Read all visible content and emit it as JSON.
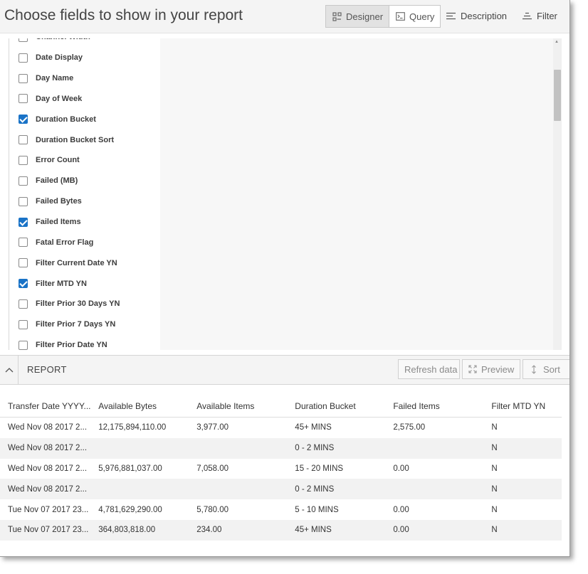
{
  "header": {
    "title": "Choose fields to show in your report",
    "designer_label": "Designer",
    "query_label": "Query",
    "description_label": "Description",
    "filter_label": "Filter"
  },
  "fields": [
    {
      "label": "Channel Width",
      "checked": false
    },
    {
      "label": "Date Display",
      "checked": false
    },
    {
      "label": "Day Name",
      "checked": false
    },
    {
      "label": "Day of Week",
      "checked": false
    },
    {
      "label": "Duration Bucket",
      "checked": true
    },
    {
      "label": "Duration Bucket Sort",
      "checked": false
    },
    {
      "label": "Error Count",
      "checked": false
    },
    {
      "label": "Failed (MB)",
      "checked": false
    },
    {
      "label": "Failed Bytes",
      "checked": false
    },
    {
      "label": "Failed Items",
      "checked": true
    },
    {
      "label": "Fatal Error Flag",
      "checked": false
    },
    {
      "label": "Filter Current Date YN",
      "checked": false
    },
    {
      "label": "Filter MTD YN",
      "checked": true
    },
    {
      "label": "Filter Prior 30 Days YN",
      "checked": false
    },
    {
      "label": "Filter Prior 7 Days YN",
      "checked": false
    },
    {
      "label": "Filter Prior Date YN",
      "checked": false
    }
  ],
  "report": {
    "label": "REPORT",
    "refresh_label": "Refresh data",
    "preview_label": "Preview",
    "sort_label": "Sort"
  },
  "table": {
    "columns": [
      "Transfer Date YYYY...",
      "Available Bytes",
      "Available Items",
      "Duration Bucket",
      "Failed Items",
      "Filter MTD YN"
    ],
    "rows": [
      [
        "Wed Nov 08 2017 2...",
        "12,175,894,110.00",
        "3,977.00",
        "45+ MINS",
        "2,575.00",
        "N"
      ],
      [
        "Wed Nov 08 2017 2...",
        "",
        "",
        "0 - 2 MINS",
        "",
        "N"
      ],
      [
        "Wed Nov 08 2017 2...",
        "5,976,881,037.00",
        "7,058.00",
        "15 - 20 MINS",
        "0.00",
        "N"
      ],
      [
        "Wed Nov 08 2017 2...",
        "",
        "",
        "0 - 2 MINS",
        "",
        "N"
      ],
      [
        "Tue Nov 07 2017 23...",
        "4,781,629,290.00",
        "5,780.00",
        "5 - 10 MINS",
        "0.00",
        "N"
      ],
      [
        "Tue Nov 07 2017 23...",
        "364,803,818.00",
        "234.00",
        "45+ MINS",
        "0.00",
        "N"
      ]
    ]
  },
  "colors": {
    "accent": "#1a73c7",
    "header_bg": "#f4f4f4",
    "row_alt": "#f2f2f2"
  }
}
